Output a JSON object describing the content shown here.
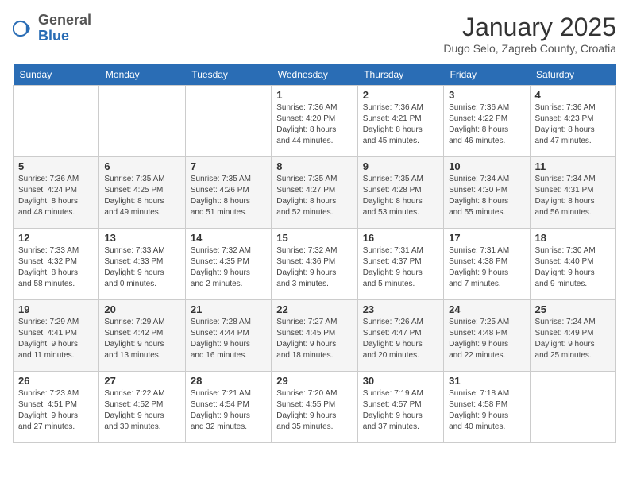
{
  "header": {
    "logo_general": "General",
    "logo_blue": "Blue",
    "month_title": "January 2025",
    "location": "Dugo Selo, Zagreb County, Croatia"
  },
  "days_of_week": [
    "Sunday",
    "Monday",
    "Tuesday",
    "Wednesday",
    "Thursday",
    "Friday",
    "Saturday"
  ],
  "weeks": [
    [
      {
        "day": "",
        "detail": ""
      },
      {
        "day": "",
        "detail": ""
      },
      {
        "day": "",
        "detail": ""
      },
      {
        "day": "1",
        "detail": "Sunrise: 7:36 AM\nSunset: 4:20 PM\nDaylight: 8 hours\nand 44 minutes."
      },
      {
        "day": "2",
        "detail": "Sunrise: 7:36 AM\nSunset: 4:21 PM\nDaylight: 8 hours\nand 45 minutes."
      },
      {
        "day": "3",
        "detail": "Sunrise: 7:36 AM\nSunset: 4:22 PM\nDaylight: 8 hours\nand 46 minutes."
      },
      {
        "day": "4",
        "detail": "Sunrise: 7:36 AM\nSunset: 4:23 PM\nDaylight: 8 hours\nand 47 minutes."
      }
    ],
    [
      {
        "day": "5",
        "detail": "Sunrise: 7:36 AM\nSunset: 4:24 PM\nDaylight: 8 hours\nand 48 minutes."
      },
      {
        "day": "6",
        "detail": "Sunrise: 7:35 AM\nSunset: 4:25 PM\nDaylight: 8 hours\nand 49 minutes."
      },
      {
        "day": "7",
        "detail": "Sunrise: 7:35 AM\nSunset: 4:26 PM\nDaylight: 8 hours\nand 51 minutes."
      },
      {
        "day": "8",
        "detail": "Sunrise: 7:35 AM\nSunset: 4:27 PM\nDaylight: 8 hours\nand 52 minutes."
      },
      {
        "day": "9",
        "detail": "Sunrise: 7:35 AM\nSunset: 4:28 PM\nDaylight: 8 hours\nand 53 minutes."
      },
      {
        "day": "10",
        "detail": "Sunrise: 7:34 AM\nSunset: 4:30 PM\nDaylight: 8 hours\nand 55 minutes."
      },
      {
        "day": "11",
        "detail": "Sunrise: 7:34 AM\nSunset: 4:31 PM\nDaylight: 8 hours\nand 56 minutes."
      }
    ],
    [
      {
        "day": "12",
        "detail": "Sunrise: 7:33 AM\nSunset: 4:32 PM\nDaylight: 8 hours\nand 58 minutes."
      },
      {
        "day": "13",
        "detail": "Sunrise: 7:33 AM\nSunset: 4:33 PM\nDaylight: 9 hours\nand 0 minutes."
      },
      {
        "day": "14",
        "detail": "Sunrise: 7:32 AM\nSunset: 4:35 PM\nDaylight: 9 hours\nand 2 minutes."
      },
      {
        "day": "15",
        "detail": "Sunrise: 7:32 AM\nSunset: 4:36 PM\nDaylight: 9 hours\nand 3 minutes."
      },
      {
        "day": "16",
        "detail": "Sunrise: 7:31 AM\nSunset: 4:37 PM\nDaylight: 9 hours\nand 5 minutes."
      },
      {
        "day": "17",
        "detail": "Sunrise: 7:31 AM\nSunset: 4:38 PM\nDaylight: 9 hours\nand 7 minutes."
      },
      {
        "day": "18",
        "detail": "Sunrise: 7:30 AM\nSunset: 4:40 PM\nDaylight: 9 hours\nand 9 minutes."
      }
    ],
    [
      {
        "day": "19",
        "detail": "Sunrise: 7:29 AM\nSunset: 4:41 PM\nDaylight: 9 hours\nand 11 minutes."
      },
      {
        "day": "20",
        "detail": "Sunrise: 7:29 AM\nSunset: 4:42 PM\nDaylight: 9 hours\nand 13 minutes."
      },
      {
        "day": "21",
        "detail": "Sunrise: 7:28 AM\nSunset: 4:44 PM\nDaylight: 9 hours\nand 16 minutes."
      },
      {
        "day": "22",
        "detail": "Sunrise: 7:27 AM\nSunset: 4:45 PM\nDaylight: 9 hours\nand 18 minutes."
      },
      {
        "day": "23",
        "detail": "Sunrise: 7:26 AM\nSunset: 4:47 PM\nDaylight: 9 hours\nand 20 minutes."
      },
      {
        "day": "24",
        "detail": "Sunrise: 7:25 AM\nSunset: 4:48 PM\nDaylight: 9 hours\nand 22 minutes."
      },
      {
        "day": "25",
        "detail": "Sunrise: 7:24 AM\nSunset: 4:49 PM\nDaylight: 9 hours\nand 25 minutes."
      }
    ],
    [
      {
        "day": "26",
        "detail": "Sunrise: 7:23 AM\nSunset: 4:51 PM\nDaylight: 9 hours\nand 27 minutes."
      },
      {
        "day": "27",
        "detail": "Sunrise: 7:22 AM\nSunset: 4:52 PM\nDaylight: 9 hours\nand 30 minutes."
      },
      {
        "day": "28",
        "detail": "Sunrise: 7:21 AM\nSunset: 4:54 PM\nDaylight: 9 hours\nand 32 minutes."
      },
      {
        "day": "29",
        "detail": "Sunrise: 7:20 AM\nSunset: 4:55 PM\nDaylight: 9 hours\nand 35 minutes."
      },
      {
        "day": "30",
        "detail": "Sunrise: 7:19 AM\nSunset: 4:57 PM\nDaylight: 9 hours\nand 37 minutes."
      },
      {
        "day": "31",
        "detail": "Sunrise: 7:18 AM\nSunset: 4:58 PM\nDaylight: 9 hours\nand 40 minutes."
      },
      {
        "day": "",
        "detail": ""
      }
    ]
  ]
}
